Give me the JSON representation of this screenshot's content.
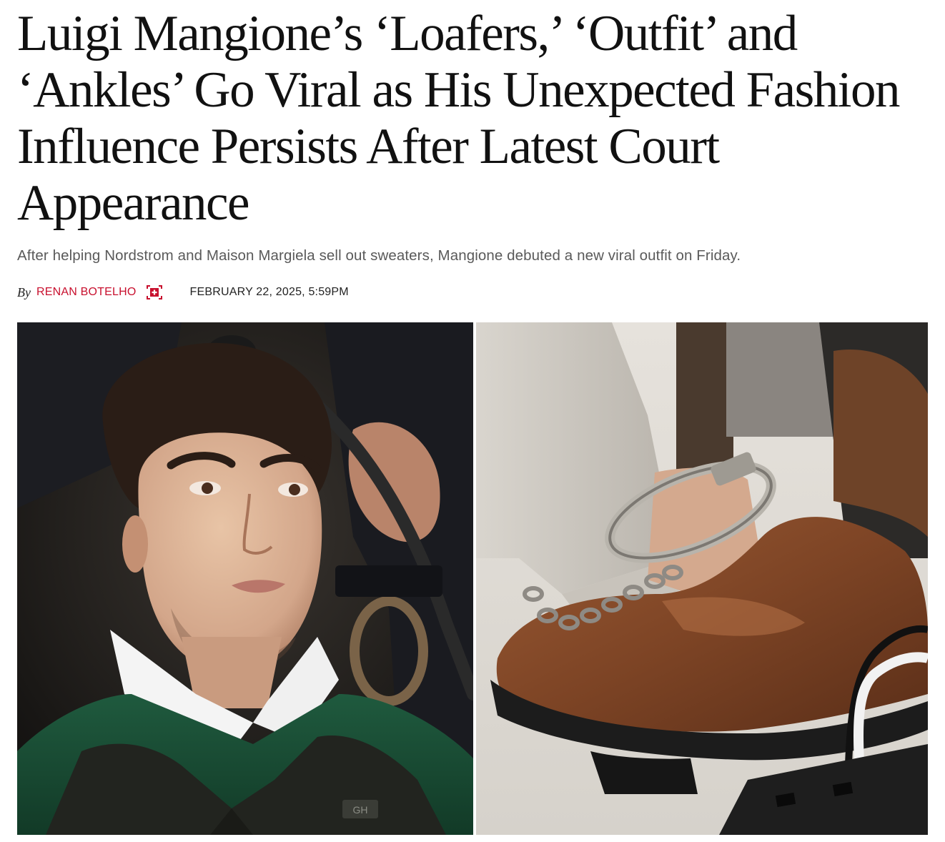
{
  "article": {
    "headline": "Luigi Mangione’s ‘Loafers,’ ‘Outfit’ and ‘Ankles’ Go Viral as His Unexpected Fashion Influence Persists After Latest Court Appearance",
    "dek": "After helping Nordstrom and Maison Margiela sell out sweaters, Mangione debuted a new viral outfit on Friday.",
    "byline": {
      "by": "By",
      "author": "RENAN BOTELHO",
      "follow_icon": "plus-square-icon",
      "date": "FEBRUARY 22, 2025, 5:59PM"
    },
    "hero": {
      "left_image": "portrait-photo",
      "right_image": "loafer-shackle-photo",
      "vest_logo": "GH"
    }
  },
  "colors": {
    "accent": "#c8102e",
    "headline": "#111111",
    "dek": "#5a5a5a"
  }
}
